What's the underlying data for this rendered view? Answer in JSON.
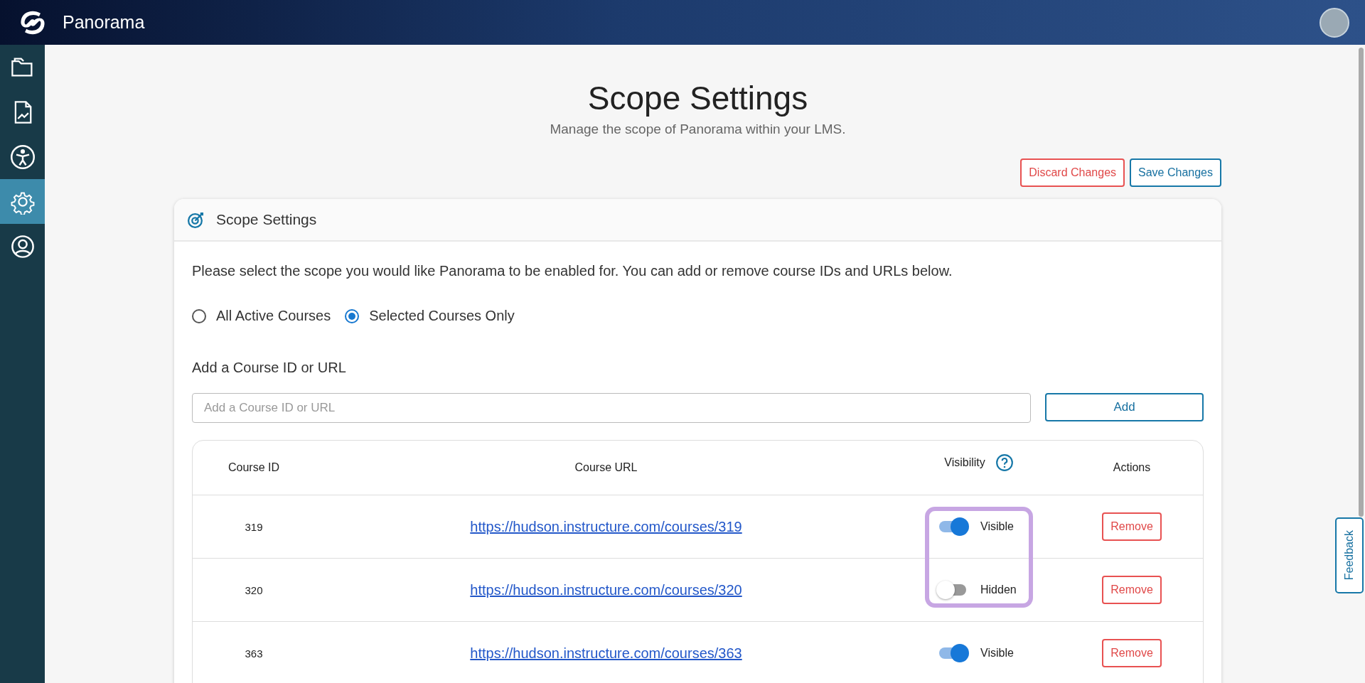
{
  "app": {
    "name": "Panorama"
  },
  "sidebar": {
    "items": [
      {
        "kind": "folders",
        "selected": false
      },
      {
        "kind": "report",
        "selected": false
      },
      {
        "kind": "accessibility",
        "selected": false
      },
      {
        "kind": "settings",
        "selected": true
      },
      {
        "kind": "account",
        "selected": false
      }
    ]
  },
  "page": {
    "title": "Scope Settings",
    "subtitle": "Manage the scope of Panorama within your LMS."
  },
  "actions": {
    "discard": "Discard Changes",
    "save": "Save Changes"
  },
  "card": {
    "title": "Scope Settings",
    "intro": "Please select the scope you would like Panorama to be enabled for. You can add or remove course IDs and URLs below.",
    "scope_options": [
      {
        "label": "All Active Courses",
        "selected": false
      },
      {
        "label": "Selected Courses Only",
        "selected": true
      }
    ],
    "add_label": "Add a Course ID or URL",
    "add_field": {
      "placeholder": "Add a Course ID or URL"
    },
    "add_button": "Add",
    "table": {
      "columns": [
        "Course ID",
        "Course URL",
        "Visibility",
        "Actions"
      ],
      "rows": [
        {
          "id": "319",
          "url": "https://hudson.instructure.com/courses/319",
          "visible": true,
          "visibility": "Visible",
          "action": "Remove"
        },
        {
          "id": "320",
          "url": "https://hudson.instructure.com/courses/320",
          "visible": false,
          "visibility": "Hidden",
          "action": "Remove"
        },
        {
          "id": "363",
          "url": "https://hudson.instructure.com/courses/363",
          "visible": true,
          "visibility": "Visible",
          "action": "Remove"
        }
      ]
    }
  },
  "feedback": "Feedback"
}
